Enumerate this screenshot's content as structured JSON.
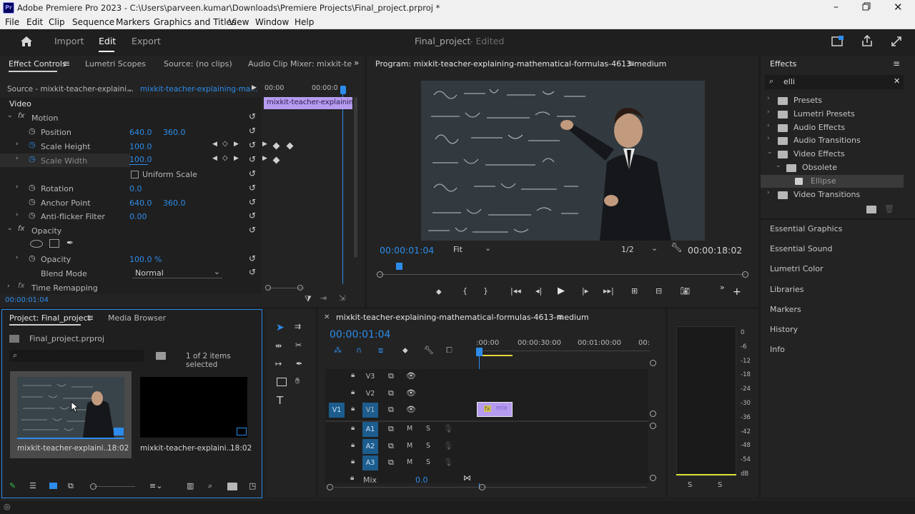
{
  "window": {
    "title": "Adobe Premiere Pro 2023 - C:\\Users\\parveen.kumar\\Downloads\\Premiere Projects\\Final_project.prproj *",
    "app_icon": "Pr"
  },
  "menu": [
    "File",
    "Edit",
    "Clip",
    "Sequence",
    "Markers",
    "Graphics and Titles",
    "View",
    "Window",
    "Help"
  ],
  "header": {
    "tabs": [
      "Import",
      "Edit",
      "Export"
    ],
    "active_tab": "Edit",
    "project_name": "Final_project",
    "status": "- Edited"
  },
  "effect_controls": {
    "tabs": [
      "Effect Controls",
      "Lumetri Scopes",
      "Source: (no clips)",
      "Audio Clip Mixer: mixkit-te"
    ],
    "source_label": "Source - mixkit-teacher-explaini...",
    "clip_label": "mixkit-teacher-explaining-ma...",
    "time_start": "00:00",
    "time_end": "00:00:0",
    "clip_bar": "mixkit-teacher-explaining",
    "video_label": "Video",
    "motion_label": "Motion",
    "position_label": "Position",
    "position_x": "640.0",
    "position_y": "360.0",
    "scale_height_label": "Scale Height",
    "scale_height": "100.0",
    "scale_width_label": "Scale Width",
    "scale_width": "100.0",
    "uniform_scale_label": "Uniform Scale",
    "rotation_label": "Rotation",
    "rotation": "0.0",
    "anchor_label": "Anchor Point",
    "anchor_x": "640.0",
    "anchor_y": "360.0",
    "antiflicker_label": "Anti-flicker Filter",
    "antiflicker": "0.00",
    "opacity_group": "Opacity",
    "opacity_label": "Opacity",
    "opacity": "100.0 %",
    "blend_label": "Blend Mode",
    "blend_value": "Normal",
    "time_remap_label": "Time Remapping",
    "timecode": "00:00:01:04"
  },
  "program": {
    "title": "Program: mixkit-teacher-explaining-mathematical-formulas-4613-medium",
    "timecode": "00:00:01:04",
    "fit": "Fit",
    "resolution": "1/2",
    "duration": "00:00:18:02"
  },
  "effects": {
    "title": "Effects",
    "search_value": "elli",
    "tree": [
      {
        "label": "Presets",
        "level": 0
      },
      {
        "label": "Lumetri Presets",
        "level": 0
      },
      {
        "label": "Audio Effects",
        "level": 0
      },
      {
        "label": "Audio Transitions",
        "level": 0
      },
      {
        "label": "Video Effects",
        "level": 0
      },
      {
        "label": "Obsolete",
        "level": 1
      },
      {
        "label": "Ellipse",
        "level": 2
      },
      {
        "label": "Video Transitions",
        "level": 0
      }
    ],
    "panels": [
      "Essential Graphics",
      "Essential Sound",
      "Lumetri Color",
      "Libraries",
      "Markers",
      "History",
      "Info"
    ]
  },
  "project": {
    "tabs": [
      "Project: Final_project",
      "Media Browser"
    ],
    "file": "Final_project.prproj",
    "selection": "1 of 2 items selected",
    "items": [
      {
        "name": "mixkit-teacher-explaini...",
        "duration": "18:02"
      },
      {
        "name": "mixkit-teacher-explaini...",
        "duration": "18:02"
      }
    ]
  },
  "timeline": {
    "title": "mixkit-teacher-explaining-mathematical-formulas-4613-medium",
    "timecode": "00:00:01:04",
    "ruler": [
      ":00:00",
      "00:00:30:00",
      "00:01:00:00",
      "00:"
    ],
    "video_tracks": [
      "V3",
      "V2",
      "V1"
    ],
    "source_patch": "V1",
    "audio_tracks": [
      "A1",
      "A2",
      "A3"
    ],
    "mute": "M",
    "solo": "S",
    "mix_label": "Mix",
    "mix_value": "0.0",
    "clip_label": "mix",
    "fx_badge": "fx"
  },
  "meter": {
    "scale": [
      "0",
      "-6",
      "-12",
      "-18",
      "-24",
      "-30",
      "-36",
      "-42",
      "-48",
      "-54",
      "dB"
    ],
    "solo": [
      "S",
      "S"
    ]
  },
  "colors": {
    "accent": "#2d8ceb",
    "clip": "#b69cf0",
    "bg": "#232323"
  }
}
